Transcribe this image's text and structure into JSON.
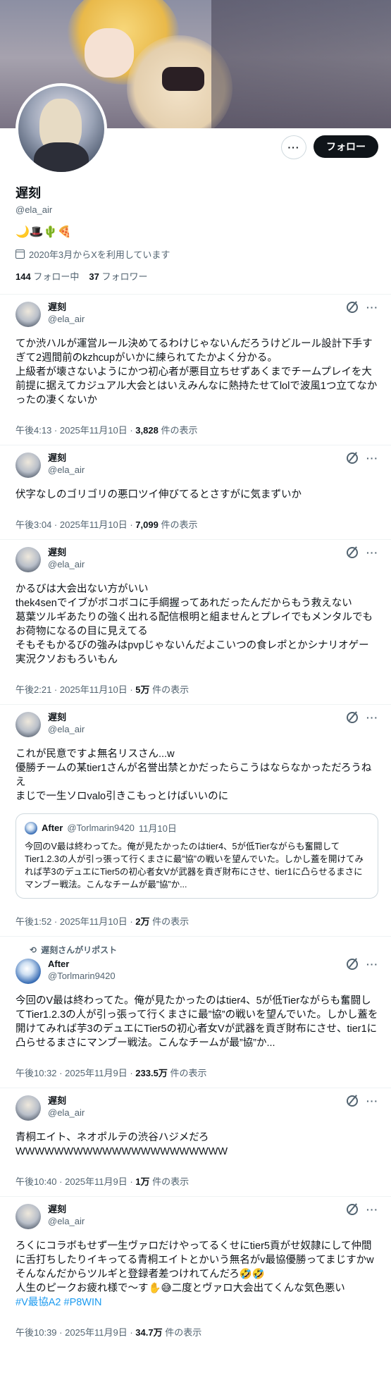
{
  "profile": {
    "display_name": "遅刻",
    "handle": "@ela_air",
    "bio_emojis": "🌙🎩🌵🍕",
    "joined": "2020年3月からXを利用しています",
    "following_count": "144",
    "following_label": "フォロー中",
    "followers_count": "37",
    "followers_label": "フォロワー",
    "follow_button": "フォロー",
    "more_button": "···"
  },
  "icons": {
    "more": "···",
    "grok": "grok-icon",
    "repost": "⟲"
  },
  "tweets": [
    {
      "name": "遅刻",
      "handle": "@ela_air",
      "text": "てか渋ハルが運営ルール決めてるわけじゃないんだろうけどルール設計下手すぎて2週間前のkzhcupがいかに練られてたかよく分かる。\n上級者が壊さないようにかつ初心者が悪目立ちせずあくまでチームプレイを大前提に据えてカジュアル大会とはいえみんなに熱持たせてlolで波風1つ立てなかったの凄くないか",
      "time": "午後4:13 · 2025年11月10日 · ",
      "views": "3,828",
      "views_label": " 件の表示"
    },
    {
      "name": "遅刻",
      "handle": "@ela_air",
      "text": "伏字なしのゴリゴリの悪口ツイ伸びてるとさすがに気まずいか",
      "time": "午後3:04 · 2025年11月10日 · ",
      "views": "7,099",
      "views_label": " 件の表示"
    },
    {
      "name": "遅刻",
      "handle": "@ela_air",
      "text": "かるびは大会出ない方がいい\nthek4senでイブがボコボコに手綱握ってあれだったんだからもう救えない\n葛葉ツルギあたりの強く出れる配信根明と組ませんとプレイでもメンタルでもお荷物になるの目に見えてる\nそもそもかるびの強みはpvpじゃないんだよこいつの食レポとかシナリオゲー実況クソおもろいもん",
      "time": "午後2:21 · 2025年11月10日 · ",
      "views": "5万",
      "views_label": " 件の表示"
    },
    {
      "name": "遅刻",
      "handle": "@ela_air",
      "text": "これが民意ですよ無名リスさん...w\n優勝チームの某tier1さんが名誉出禁とかだったらこうはならなかっただろうねえ\nまじで一生ソロvalo引きこもっとけばいいのに",
      "quote": {
        "name": "After",
        "handle": "@Torlmarin9420",
        "date": "11月10日",
        "text": "今回のV最は終わってた。俺が見たかったのはtier4、5が低Tierながらも奮闘してTier1.2.3の人が引っ張って行くまさに最”協”の戦いを望んでいた。しかし蓋を開けてみれば芋3のデュエにTier5の初心者女Vが武器を貢ぎ財布にさせ、tier1に凸らせるまさにマンブー戦法。こんなチームが最”協”か..."
      },
      "time": "午後1:52 · 2025年11月10日 · ",
      "views": "2万",
      "views_label": " 件の表示"
    },
    {
      "repost_by": "遅刻さんがリポスト",
      "name": "After",
      "handle": "@Torlmarin9420",
      "text": "今回のV最は終わってた。俺が見たかったのはtier4、5が低Tierながらも奮闘してTier1.2.3の人が引っ張って行くまさに最”協”の戦いを望んでいた。しかし蓋を開けてみれば芋3のデュエにTier5の初心者女Vが武器を貢ぎ財布にさせ、tier1に凸らせるまさにマンブー戦法。こんなチームが最”協”か...",
      "time": "午後10:32 · 2025年11月9日 · ",
      "views": "233.5万",
      "views_label": " 件の表示"
    },
    {
      "name": "遅刻",
      "handle": "@ela_air",
      "text": "青桐エイト、ネオポルテの渋谷ハジメだろ\nWWWWWWWWWWWWWWWWWWWWWW",
      "time": "午後10:40 · 2025年11月9日 · ",
      "views": "1万",
      "views_label": " 件の表示"
    },
    {
      "name": "遅刻",
      "handle": "@ela_air",
      "text": "ろくにコラボもせず一生ヴァロだけやってるくせにtier5貢がせ奴隷にして仲間に舌打ちしたりイキってる青桐エイトとかいう無名がv最協優勝ってまじすかw\nそんなんだからツルギと登録者差つけれてんだろ🤣🤣\n人生のピークお疲れ様で〜す✋😅二度とヴァロ大会出てくんな気色悪い",
      "hashtags": "#V最協A2 #P8WIN",
      "time": "午後10:39 · 2025年11月9日 · ",
      "views": "34.7万",
      "views_label": " 件の表示"
    }
  ]
}
